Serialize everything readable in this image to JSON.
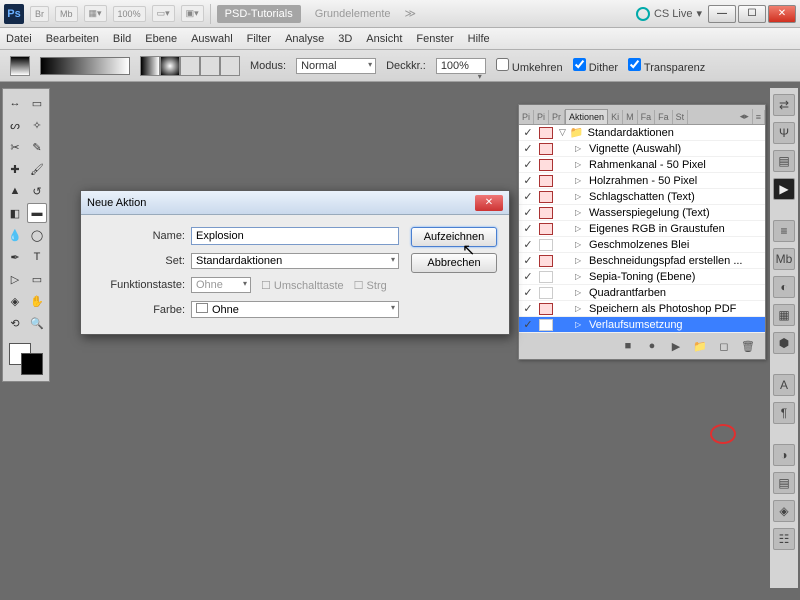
{
  "titlebar": {
    "zoom": "100%",
    "tabs": [
      "PSD-Tutorials",
      "Grundelemente"
    ],
    "cslive": "CS Live"
  },
  "menu": [
    "Datei",
    "Bearbeiten",
    "Bild",
    "Ebene",
    "Auswahl",
    "Filter",
    "Analyse",
    "3D",
    "Ansicht",
    "Fenster",
    "Hilfe"
  ],
  "options": {
    "modus_label": "Modus:",
    "modus_value": "Normal",
    "deckkr_label": "Deckkr.:",
    "deckkr_value": "100%",
    "umkehren": "Umkehren",
    "dither": "Dither",
    "transparenz": "Transparenz"
  },
  "dialog": {
    "title": "Neue Aktion",
    "name_label": "Name:",
    "name_value": "Explosion",
    "set_label": "Set:",
    "set_value": "Standardaktionen",
    "fkey_label": "Funktionstaste:",
    "fkey_value": "Ohne",
    "shift": "Umschalttaste",
    "ctrl": "Strg",
    "color_label": "Farbe:",
    "color_value": "Ohne",
    "record": "Aufzeichnen",
    "cancel": "Abbrechen"
  },
  "panel": {
    "tabs": [
      "Pi",
      "Pi",
      "Pr",
      "Aktionen",
      "Ki",
      "M",
      "Fa",
      "Fa",
      "St"
    ],
    "folder": "Standardaktionen",
    "actions": [
      {
        "label": "Vignette (Auswahl)",
        "dlg": true
      },
      {
        "label": "Rahmenkanal - 50 Pixel",
        "dlg": true
      },
      {
        "label": "Holzrahmen - 50 Pixel",
        "dlg": true
      },
      {
        "label": "Schlagschatten (Text)",
        "dlg": true
      },
      {
        "label": "Wasserspiegelung (Text)",
        "dlg": true
      },
      {
        "label": "Eigenes RGB in Graustufen",
        "dlg": true
      },
      {
        "label": "Geschmolzenes Blei",
        "dlg": false
      },
      {
        "label": "Beschneidungspfad erstellen ...",
        "dlg": true
      },
      {
        "label": "Sepia-Toning (Ebene)",
        "dlg": false
      },
      {
        "label": "Quadrantfarben",
        "dlg": false
      },
      {
        "label": "Speichern als Photoshop PDF",
        "dlg": true
      },
      {
        "label": "Verlaufsumsetzung",
        "dlg": false,
        "selected": true
      }
    ]
  }
}
